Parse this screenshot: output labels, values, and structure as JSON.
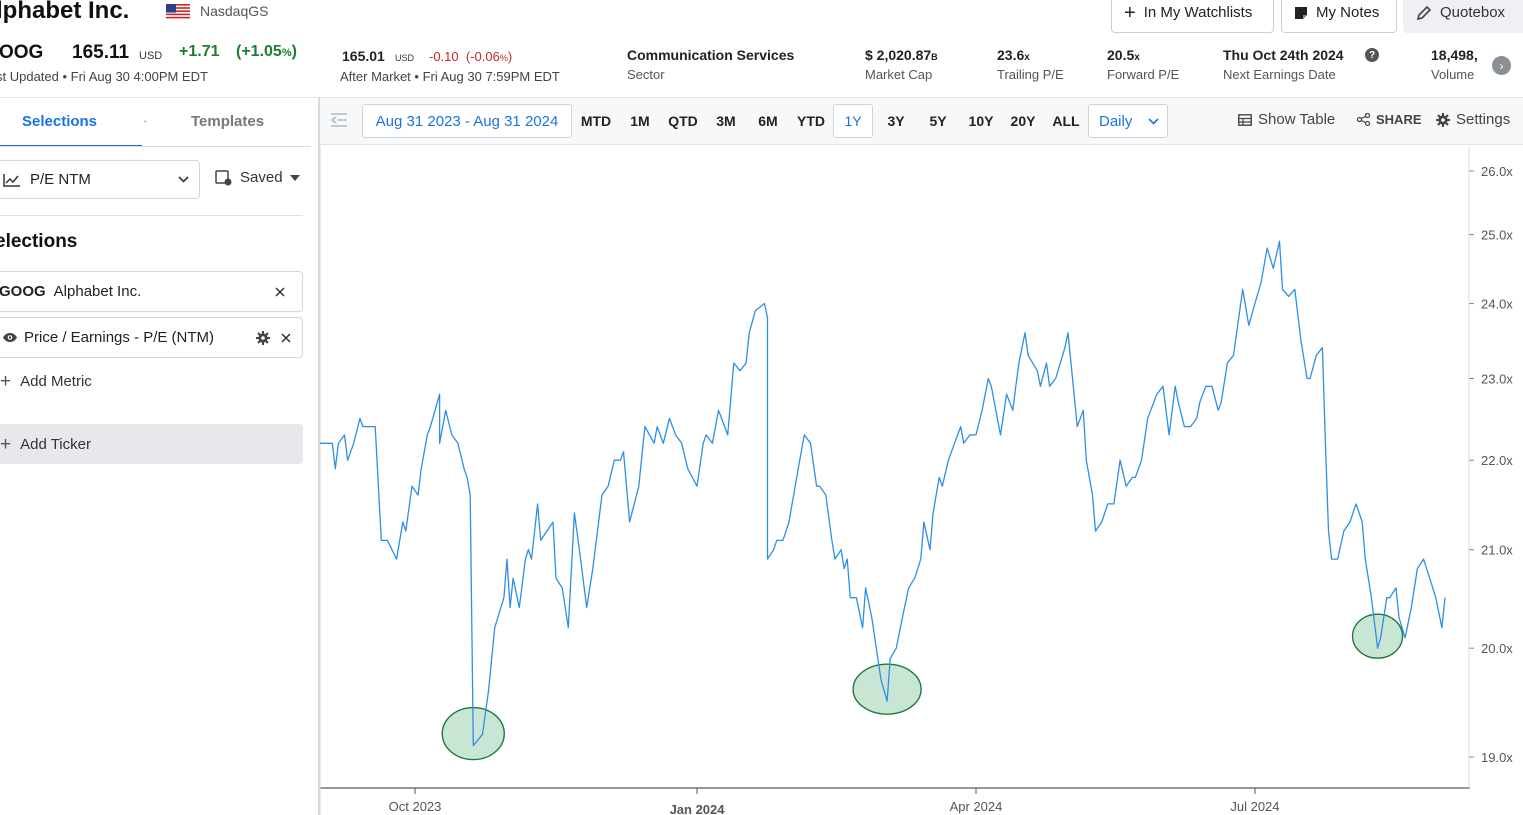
{
  "header": {
    "company_name": "lphabet Inc.",
    "exchange": "NasdaqGS",
    "buttons": {
      "watchlists": "In My Watchlists",
      "notes": "My Notes",
      "quotebox": "Quotebox"
    },
    "quote": {
      "ticker": "OOG",
      "price": "165.11",
      "currency": "USD",
      "change": "+1.71",
      "change_pct_open": "(+1.05",
      "change_pct_unit": "%",
      "change_pct_close": ")",
      "last_updated": "st Updated • Fri Aug 30 4:00PM EDT",
      "after_hours_price": "165.01",
      "after_hours_currency": "USD",
      "after_hours_change": "-0.10",
      "after_hours_change_pct_open": "(-0.06",
      "after_hours_change_pct_unit": "%",
      "after_hours_change_pct_close": ")",
      "after_hours_updated": "After Market • Fri Aug 30 7:59PM EDT"
    },
    "stats": [
      {
        "value": "Communication Services",
        "suffix": "",
        "label": "Sector"
      },
      {
        "value": "$ 2,020.87",
        "suffix": "B",
        "label": "Market Cap"
      },
      {
        "value": "23.6",
        "suffix": "x",
        "label": "Trailing P/E"
      },
      {
        "value": "20.5",
        "suffix": "x",
        "label": "Forward P/E"
      },
      {
        "value": "Thu Oct 24th 2024",
        "suffix": "",
        "label": "Next Earnings Date"
      },
      {
        "value": "18,498,",
        "suffix": "",
        "label": "Volume"
      }
    ],
    "help_glyph": "?",
    "next_glyph": "›"
  },
  "sidebar": {
    "tabs": {
      "selections": "Selections",
      "separator": "·",
      "templates": "Templates"
    },
    "metric_select": "P/E NTM",
    "saved_label": "Saved",
    "selections_heading": "elections",
    "ticker_item": {
      "symbol": "GOOG",
      "name": "Alphabet Inc."
    },
    "metric_item": "Price / Earnings - P/E (NTM)",
    "add_metric": "Add Metric",
    "add_ticker": "Add Ticker"
  },
  "toolbar": {
    "date_range": "Aug 31 2023 - Aug 31 2024",
    "ranges": [
      "MTD",
      "1M",
      "QTD",
      "3M",
      "6M",
      "YTD",
      "1Y",
      "3Y",
      "5Y",
      "10Y",
      "20Y",
      "ALL"
    ],
    "active_range": "1Y",
    "frequency": "Daily",
    "show_table": "Show Table",
    "share": "SHARE",
    "settings": "Settings"
  },
  "colors": {
    "accent": "#1a73e8",
    "line": "#2d8fe6",
    "positive": "#1e7d32",
    "negative": "#c62828",
    "highlight_fill": "#b7dcc5",
    "highlight_stroke": "#1f7a3a"
  },
  "chart_data": {
    "type": "line",
    "series": [
      {
        "values": [
          [
            "2023-08-31",
            22.2
          ],
          [
            "2023-09-02",
            22.2
          ],
          [
            "2023-09-04",
            22.2
          ],
          [
            "2023-09-05",
            21.9
          ],
          [
            "2023-09-06",
            22.2
          ],
          [
            "2023-09-08",
            22.3
          ],
          [
            "2023-09-09",
            22.0
          ],
          [
            "2023-09-11",
            22.2
          ],
          [
            "2023-09-13",
            22.5
          ],
          [
            "2023-09-14",
            22.4
          ],
          [
            "2023-09-17",
            22.4
          ],
          [
            "2023-09-18",
            22.4
          ],
          [
            "2023-09-20",
            21.1
          ],
          [
            "2023-09-22",
            21.1
          ],
          [
            "2023-09-25",
            20.9
          ],
          [
            "2023-09-27",
            21.3
          ],
          [
            "2023-09-28",
            21.2
          ],
          [
            "2023-09-30",
            21.7
          ],
          [
            "2023-10-02",
            21.6
          ],
          [
            "2023-10-03",
            21.9
          ],
          [
            "2023-10-05",
            22.3
          ],
          [
            "2023-10-06",
            22.4
          ],
          [
            "2023-10-09",
            22.8
          ],
          [
            "2023-10-09",
            22.2
          ],
          [
            "2023-10-11",
            22.6
          ],
          [
            "2023-10-13",
            22.3
          ],
          [
            "2023-10-15",
            22.2
          ],
          [
            "2023-10-17",
            21.9
          ],
          [
            "2023-10-18",
            21.8
          ],
          [
            "2023-10-19",
            21.6
          ],
          [
            "2023-10-20",
            19.1
          ],
          [
            "2023-10-23",
            19.2
          ],
          [
            "2023-10-25",
            19.6
          ],
          [
            "2023-10-26",
            19.9
          ],
          [
            "2023-10-27",
            20.2
          ],
          [
            "2023-10-28",
            20.3
          ],
          [
            "2023-10-30",
            20.5
          ],
          [
            "2023-10-31",
            20.9
          ],
          [
            "2023-11-01",
            20.4
          ],
          [
            "2023-11-02",
            20.7
          ],
          [
            "2023-11-04",
            20.4
          ],
          [
            "2023-11-06",
            20.9
          ],
          [
            "2023-11-07",
            21.0
          ],
          [
            "2023-11-08",
            20.9
          ],
          [
            "2023-11-10",
            21.5
          ],
          [
            "2023-11-11",
            21.1
          ],
          [
            "2023-11-13",
            21.2
          ],
          [
            "2023-11-15",
            21.3
          ],
          [
            "2023-11-16",
            20.7
          ],
          [
            "2023-11-18",
            20.6
          ],
          [
            "2023-11-20",
            20.2
          ],
          [
            "2023-11-22",
            21.4
          ],
          [
            "2023-11-24",
            20.9
          ],
          [
            "2023-11-26",
            20.4
          ],
          [
            "2023-11-28",
            20.8
          ],
          [
            "2023-12-01",
            21.6
          ],
          [
            "2023-12-03",
            21.7
          ],
          [
            "2023-12-05",
            22.0
          ],
          [
            "2023-12-07",
            22.0
          ],
          [
            "2023-12-08",
            22.1
          ],
          [
            "2023-12-10",
            21.3
          ],
          [
            "2023-12-13",
            21.7
          ],
          [
            "2023-12-15",
            22.4
          ],
          [
            "2023-12-18",
            22.2
          ],
          [
            "2023-12-19",
            22.4
          ],
          [
            "2023-12-21",
            22.2
          ],
          [
            "2023-12-23",
            22.5
          ],
          [
            "2023-12-25",
            22.3
          ],
          [
            "2023-12-27",
            22.2
          ],
          [
            "2023-12-29",
            21.9
          ],
          [
            "2024-01-01",
            21.7
          ],
          [
            "2024-01-03",
            22.2
          ],
          [
            "2024-01-04",
            22.3
          ],
          [
            "2024-01-06",
            22.2
          ],
          [
            "2024-01-08",
            22.6
          ],
          [
            "2024-01-09",
            22.5
          ],
          [
            "2024-01-11",
            22.3
          ],
          [
            "2024-01-13",
            23.2
          ],
          [
            "2024-01-15",
            23.1
          ],
          [
            "2024-01-17",
            23.2
          ],
          [
            "2024-01-18",
            23.6
          ],
          [
            "2024-01-20",
            23.9
          ],
          [
            "2024-01-23",
            24.0
          ],
          [
            "2024-01-24",
            23.8
          ],
          [
            "2024-01-24",
            20.9
          ],
          [
            "2024-01-26",
            21.0
          ],
          [
            "2024-01-27",
            21.1
          ],
          [
            "2024-01-29",
            21.1
          ],
          [
            "2024-01-31",
            21.3
          ],
          [
            "2024-02-01",
            21.5
          ],
          [
            "2024-02-03",
            21.9
          ],
          [
            "2024-02-05",
            22.3
          ],
          [
            "2024-02-07",
            22.2
          ],
          [
            "2024-02-09",
            21.7
          ],
          [
            "2024-02-10",
            21.7
          ],
          [
            "2024-02-12",
            21.6
          ],
          [
            "2024-02-14",
            21.1
          ],
          [
            "2024-02-15",
            20.9
          ],
          [
            "2024-02-17",
            21.0
          ],
          [
            "2024-02-18",
            20.8
          ],
          [
            "2024-02-19",
            20.9
          ],
          [
            "2024-02-20",
            20.5
          ],
          [
            "2024-02-22",
            20.5
          ],
          [
            "2024-02-24",
            20.2
          ],
          [
            "2024-02-25",
            20.6
          ],
          [
            "2024-02-27",
            20.3
          ],
          [
            "2024-02-28",
            20.1
          ],
          [
            "2024-03-01",
            19.7
          ],
          [
            "2024-03-03",
            19.5
          ],
          [
            "2024-03-04",
            19.9
          ],
          [
            "2024-03-06",
            20.0
          ],
          [
            "2024-03-08",
            20.3
          ],
          [
            "2024-03-10",
            20.6
          ],
          [
            "2024-03-12",
            20.7
          ],
          [
            "2024-03-14",
            20.9
          ],
          [
            "2024-03-15",
            21.3
          ],
          [
            "2024-03-17",
            21.0
          ],
          [
            "2024-03-18",
            21.4
          ],
          [
            "2024-03-20",
            21.8
          ],
          [
            "2024-03-21",
            21.7
          ],
          [
            "2024-03-23",
            22.0
          ],
          [
            "2024-03-25",
            22.2
          ],
          [
            "2024-03-27",
            22.4
          ],
          [
            "2024-03-28",
            22.2
          ],
          [
            "2024-03-30",
            22.3
          ],
          [
            "2024-04-01",
            22.3
          ],
          [
            "2024-04-03",
            22.6
          ],
          [
            "2024-04-05",
            23.0
          ],
          [
            "2024-04-06",
            22.9
          ],
          [
            "2024-04-09",
            22.3
          ],
          [
            "2024-04-11",
            22.8
          ],
          [
            "2024-04-13",
            22.6
          ],
          [
            "2024-04-14",
            22.9
          ],
          [
            "2024-04-15",
            23.2
          ],
          [
            "2024-04-17",
            23.6
          ],
          [
            "2024-04-18",
            23.3
          ],
          [
            "2024-04-21",
            23.1
          ],
          [
            "2024-04-22",
            22.9
          ],
          [
            "2024-04-24",
            23.2
          ],
          [
            "2024-04-25",
            22.9
          ],
          [
            "2024-04-27",
            23.0
          ],
          [
            "2024-04-30",
            23.4
          ],
          [
            "2024-05-01",
            23.6
          ],
          [
            "2024-05-03",
            22.8
          ],
          [
            "2024-05-04",
            22.4
          ],
          [
            "2024-05-06",
            22.6
          ],
          [
            "2024-05-07",
            22.0
          ],
          [
            "2024-05-09",
            21.6
          ],
          [
            "2024-05-10",
            21.2
          ],
          [
            "2024-05-12",
            21.3
          ],
          [
            "2024-05-14",
            21.5
          ],
          [
            "2024-05-16",
            21.5
          ],
          [
            "2024-05-18",
            22.0
          ],
          [
            "2024-05-20",
            21.7
          ],
          [
            "2024-05-22",
            21.8
          ],
          [
            "2024-05-23",
            21.8
          ],
          [
            "2024-05-25",
            22.0
          ],
          [
            "2024-05-27",
            22.5
          ],
          [
            "2024-05-29",
            22.7
          ],
          [
            "2024-05-30",
            22.8
          ],
          [
            "2024-06-01",
            22.9
          ],
          [
            "2024-06-03",
            22.3
          ],
          [
            "2024-06-05",
            22.9
          ],
          [
            "2024-06-06",
            22.7
          ],
          [
            "2024-06-08",
            22.4
          ],
          [
            "2024-06-10",
            22.4
          ],
          [
            "2024-06-12",
            22.5
          ],
          [
            "2024-06-13",
            22.7
          ],
          [
            "2024-06-15",
            22.9
          ],
          [
            "2024-06-17",
            22.9
          ],
          [
            "2024-06-19",
            22.6
          ],
          [
            "2024-06-20",
            22.7
          ],
          [
            "2024-06-22",
            23.2
          ],
          [
            "2024-06-24",
            23.3
          ],
          [
            "2024-06-27",
            24.2
          ],
          [
            "2024-06-29",
            23.7
          ],
          [
            "2024-07-01",
            24.0
          ],
          [
            "2024-07-03",
            24.3
          ],
          [
            "2024-07-05",
            24.8
          ],
          [
            "2024-07-07",
            24.5
          ],
          [
            "2024-07-09",
            24.9
          ],
          [
            "2024-07-10",
            24.2
          ],
          [
            "2024-07-12",
            24.1
          ],
          [
            "2024-07-14",
            24.2
          ],
          [
            "2024-07-16",
            23.5
          ],
          [
            "2024-07-18",
            23.0
          ],
          [
            "2024-07-19",
            23.0
          ],
          [
            "2024-07-21",
            23.3
          ],
          [
            "2024-07-23",
            23.4
          ],
          [
            "2024-07-24",
            22.2
          ],
          [
            "2024-07-25",
            21.2
          ],
          [
            "2024-07-26",
            20.9
          ],
          [
            "2024-07-28",
            20.9
          ],
          [
            "2024-07-30",
            21.2
          ],
          [
            "2024-08-01",
            21.3
          ],
          [
            "2024-08-03",
            21.5
          ],
          [
            "2024-08-05",
            21.3
          ],
          [
            "2024-08-06",
            20.9
          ],
          [
            "2024-08-08",
            20.5
          ],
          [
            "2024-08-10",
            20.0
          ],
          [
            "2024-08-11",
            20.1
          ],
          [
            "2024-08-13",
            20.5
          ],
          [
            "2024-08-14",
            20.5
          ],
          [
            "2024-08-16",
            20.6
          ],
          [
            "2024-08-17",
            20.3
          ],
          [
            "2024-08-19",
            20.1
          ],
          [
            "2024-08-21",
            20.4
          ],
          [
            "2024-08-23",
            20.8
          ],
          [
            "2024-08-25",
            20.9
          ],
          [
            "2024-08-27",
            20.7
          ],
          [
            "2024-08-29",
            20.5
          ],
          [
            "2024-08-31",
            20.2
          ],
          [
            "2024-09-01",
            20.5
          ]
        ]
      }
    ],
    "x_ticks": [
      "Oct 2023",
      "Jan 2024",
      "Apr 2024",
      "Jul 2024"
    ],
    "y_ticks": [
      "19.0x",
      "20.0x",
      "21.0x",
      "22.0x",
      "23.0x",
      "24.0x",
      "25.0x",
      "26.0x"
    ],
    "y_axis": "reciprocal (inverse) scale",
    "highlighted_lows": [
      "2023-10-24",
      "2024-03-04",
      "2024-08-10"
    ]
  }
}
